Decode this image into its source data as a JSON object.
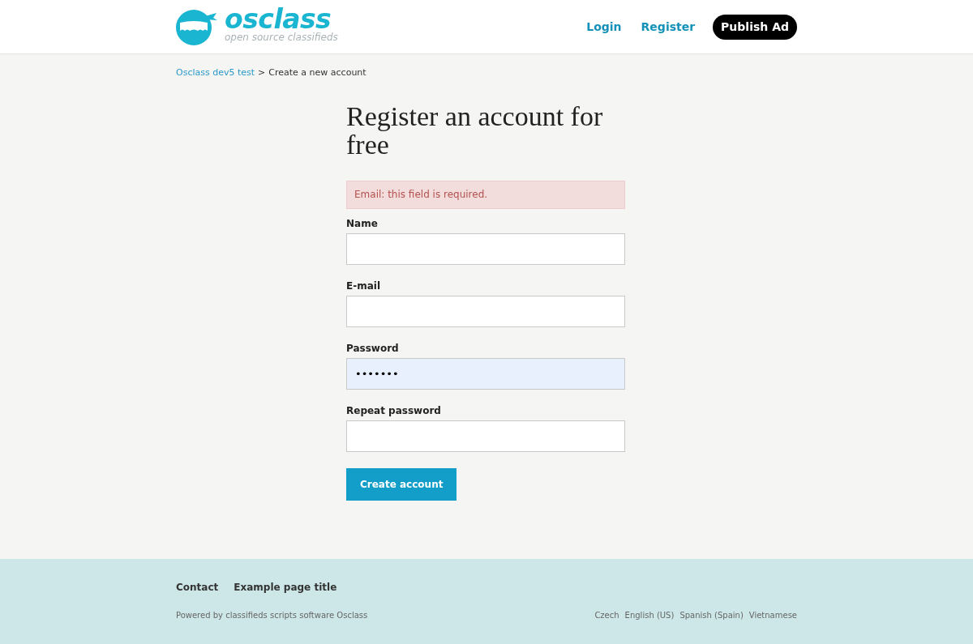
{
  "header": {
    "logo": {
      "wordmark": "osclass",
      "tagline": "open source classifieds"
    },
    "nav": [
      {
        "label": "Login",
        "kind": "link"
      },
      {
        "label": "Register",
        "kind": "link"
      },
      {
        "label": "Publish Ad",
        "kind": "pill"
      }
    ]
  },
  "breadcrumb": [
    {
      "label": "Osclass dev5 test",
      "kind": "link"
    },
    {
      "label": ">",
      "kind": "separator"
    },
    {
      "label": "Create a new account",
      "kind": "current"
    }
  ],
  "form": {
    "title": "Register an account for free",
    "alert": "Email: this field is required.",
    "fields": [
      {
        "label": "Name",
        "autofilled": false
      },
      {
        "label": "E-mail",
        "autofilled": false
      },
      {
        "label": "Password",
        "value": "•••••••",
        "autofilled": true
      },
      {
        "label": "Repeat password",
        "autofilled": false
      }
    ],
    "submit": "Create account"
  },
  "footer": {
    "links": [
      "Contact",
      "Example page title"
    ],
    "powered_by": "Powered by classifieds scripts software Osclass",
    "languages": [
      "Czech",
      "English (US)",
      "Spanish (Spain)",
      "Vietnamese"
    ]
  }
}
